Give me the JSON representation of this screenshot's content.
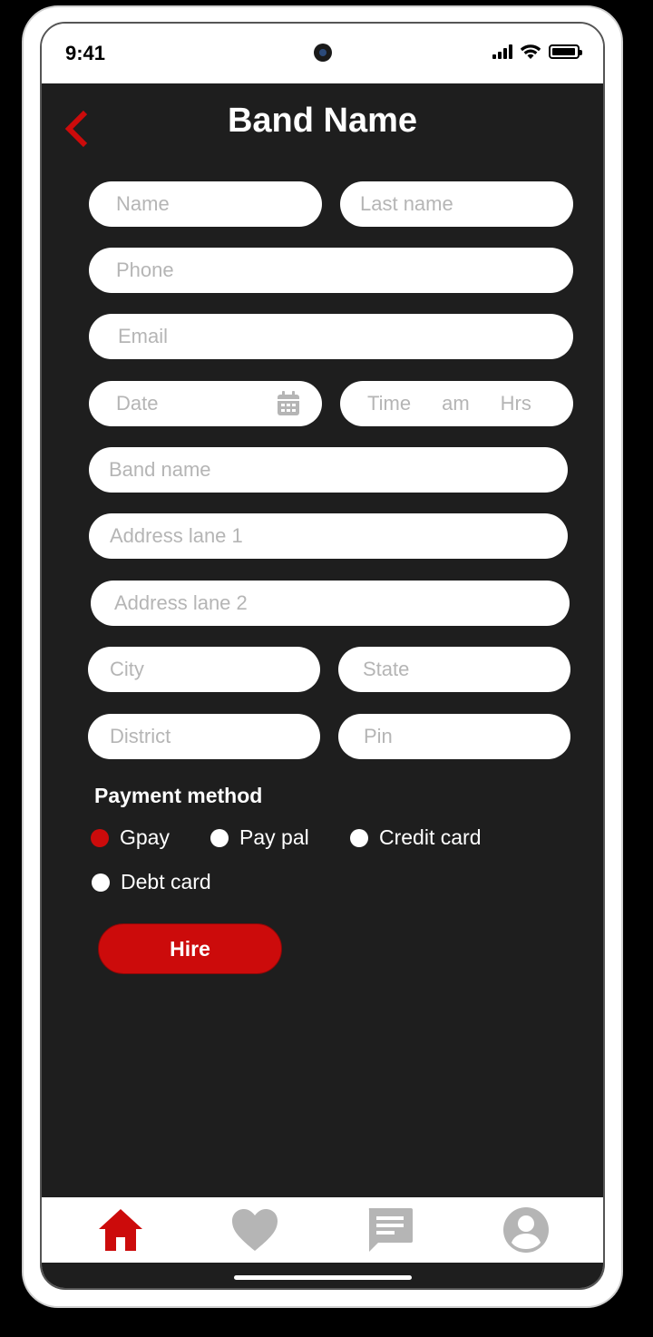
{
  "status_bar": {
    "time": "9:41"
  },
  "header": {
    "title": "Band Name"
  },
  "form": {
    "name": {
      "placeholder": "Name"
    },
    "last_name": {
      "placeholder": "Last name"
    },
    "phone": {
      "placeholder": "Phone"
    },
    "email": {
      "placeholder": "Email"
    },
    "date": {
      "placeholder": "Date"
    },
    "time": {
      "placeholder": "Time",
      "meridiem": "am",
      "unit": "Hrs"
    },
    "band_name": {
      "placeholder": "Band name"
    },
    "address1": {
      "placeholder": "Address lane 1"
    },
    "address2": {
      "placeholder": "Address lane 2"
    },
    "city": {
      "placeholder": "City"
    },
    "state": {
      "placeholder": "State"
    },
    "district": {
      "placeholder": "District"
    },
    "pin": {
      "placeholder": "Pin"
    }
  },
  "payment": {
    "label": "Payment method",
    "options": [
      {
        "label": "Gpay",
        "selected": true
      },
      {
        "label": "Pay pal",
        "selected": false
      },
      {
        "label": "Credit card",
        "selected": false
      },
      {
        "label": "Debt card",
        "selected": false
      }
    ]
  },
  "actions": {
    "hire_label": "Hire"
  },
  "nav": {
    "items": [
      {
        "icon": "home-icon",
        "active": true
      },
      {
        "icon": "heart-icon",
        "active": false
      },
      {
        "icon": "chat-icon",
        "active": false
      },
      {
        "icon": "profile-icon",
        "active": false
      }
    ]
  },
  "colors": {
    "accent": "#cc0b0b",
    "background": "#1e1e1e",
    "inactive_icon": "#b5b5b5"
  }
}
